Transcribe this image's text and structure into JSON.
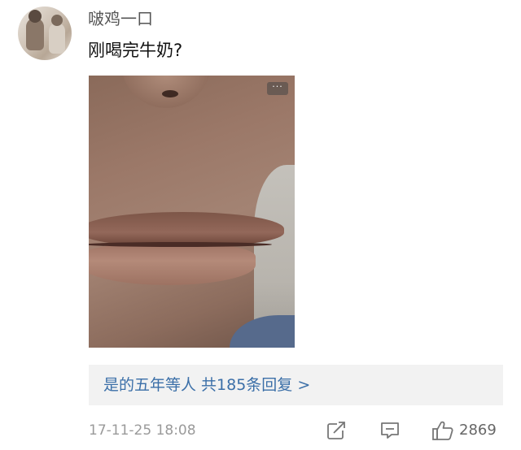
{
  "post": {
    "username": "啵鸡一口",
    "text": "刚喝完牛奶?",
    "image_menu_label": "···"
  },
  "reply": {
    "text": "是的五年等人  共185条回复 >"
  },
  "footer": {
    "timestamp": "17-11-25 18:08",
    "like_count": "2869",
    "icons": [
      "repost-icon",
      "comment-icon",
      "like-icon"
    ]
  },
  "colors": {
    "link": "#3b6fa8",
    "reply_bg": "#f2f2f2",
    "meta_text": "#9a9a9a"
  }
}
